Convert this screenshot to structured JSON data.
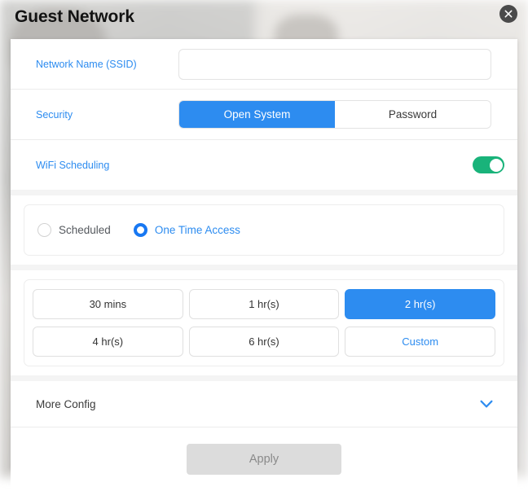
{
  "dialog": {
    "title": "Guest Network",
    "close_icon": "close-icon"
  },
  "fields": {
    "ssid": {
      "label": "Network Name (SSID)",
      "value": "",
      "placeholder": ""
    },
    "security": {
      "label": "Security",
      "options": [
        "Open System",
        "Password"
      ],
      "selected": "Open System"
    },
    "wifi_scheduling": {
      "label": "WiFi Scheduling",
      "enabled": true,
      "on_color": "#19b37a"
    }
  },
  "schedule_mode": {
    "options": [
      {
        "label": "Scheduled",
        "selected": false
      },
      {
        "label": "One Time Access",
        "selected": true
      }
    ]
  },
  "durations": {
    "options": [
      {
        "label": "30 mins",
        "selected": false,
        "link": false
      },
      {
        "label": "1 hr(s)",
        "selected": false,
        "link": false
      },
      {
        "label": "2 hr(s)",
        "selected": true,
        "link": false
      },
      {
        "label": "4 hr(s)",
        "selected": false,
        "link": false
      },
      {
        "label": "6 hr(s)",
        "selected": false,
        "link": false
      },
      {
        "label": "Custom",
        "selected": false,
        "link": true
      }
    ]
  },
  "more_config": {
    "label": "More Config",
    "expand_icon": "chevron-down-icon",
    "expanded": false
  },
  "footer": {
    "apply_label": "Apply",
    "apply_disabled": true
  },
  "colors": {
    "accent_blue": "#2d8cf0",
    "toggle_green": "#19b37a",
    "disabled_gray": "#dcdcdc"
  }
}
